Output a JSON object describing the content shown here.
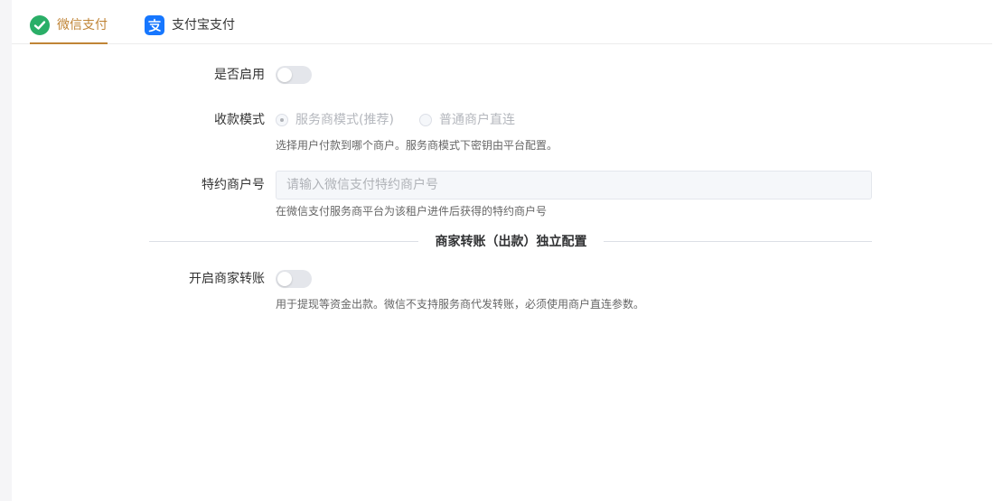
{
  "tabs": [
    {
      "label": "微信支付",
      "active": true,
      "icon": "wechat-icon"
    },
    {
      "label": "支付宝支付",
      "active": false,
      "icon": "alipay-icon"
    }
  ],
  "form": {
    "enable": {
      "label": "是否启用",
      "on": false
    },
    "mode": {
      "label": "收款模式",
      "options": [
        {
          "label": "服务商模式(推荐)",
          "checked": true
        },
        {
          "label": "普通商户直连",
          "checked": false
        }
      ],
      "hint": "选择用户付款到哪个商户。服务商模式下密钥由平台配置。"
    },
    "merchant_id": {
      "label": "特约商户号",
      "placeholder": "请输入微信支付特约商户号",
      "value": "",
      "hint": "在微信支付服务商平台为该租户进件后获得的特约商户号"
    },
    "section_title": "商家转账（出款）独立配置",
    "transfer": {
      "label": "开启商家转账",
      "on": false,
      "hint": "用于提现等资金出款。微信不支持服务商代发转账，必须使用商户直连参数。"
    }
  },
  "colors": {
    "accent": "#c08436",
    "wechat": "#2aae67",
    "alipay": "#1677ff"
  }
}
